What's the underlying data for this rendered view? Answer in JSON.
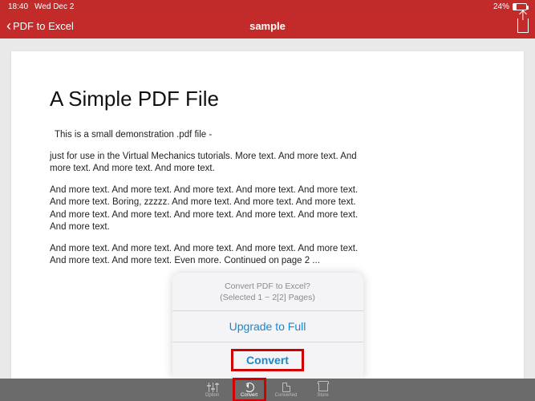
{
  "status": {
    "time": "18:40",
    "date": "Wed Dec 2",
    "battery_pct": "24%"
  },
  "nav": {
    "back_label": "PDF to Excel",
    "title": "sample"
  },
  "document": {
    "title": "A Simple PDF File",
    "p1": "This is a small demonstration .pdf file -",
    "p2": "just for use in the Virtual Mechanics tutorials. More text. And more text. And more text. And more text. And more text.",
    "p3": "And more text. And more text. And more text. And more text. And more text. And more text. Boring, zzzzz. And more text. And more text. And more text. And more text. And more text. And more text. And more text. And more text. And more text.",
    "p4": "And more text. And more text. And more text. And more text. And more text. And more text. And more text. Even more. Continued on page 2 ..."
  },
  "sheet": {
    "line1": "Convert PDF to Excel?",
    "line2": "(Selected 1 ~ 2[2] Pages)",
    "upgrade": "Upgrade to Full",
    "convert": "Convert"
  },
  "tabs": {
    "option": "Option",
    "convert": "Convert",
    "converted": "Converted",
    "store": "Store"
  }
}
